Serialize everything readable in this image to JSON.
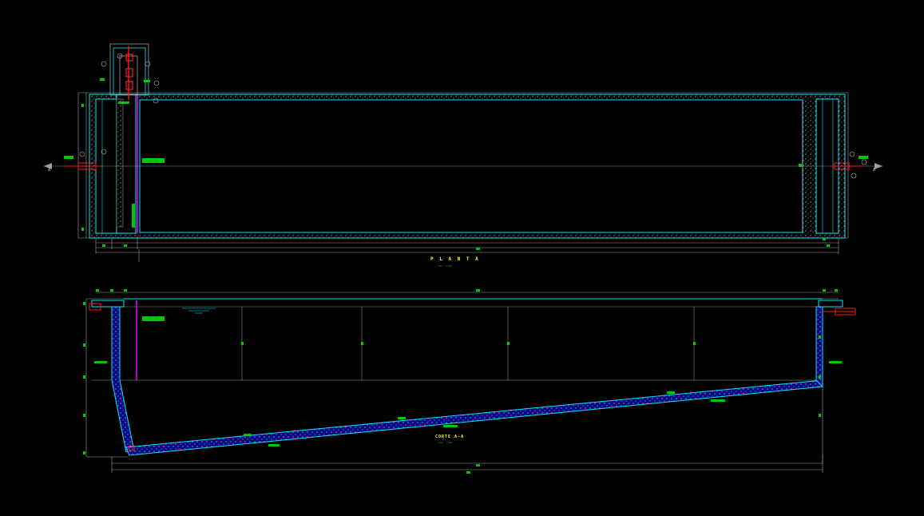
{
  "plan_view": {
    "title": "P L A N T A",
    "scale_note": "Esc. 1/50",
    "section_mark": "A"
  },
  "section_view": {
    "title": "CORTE A-A",
    "scale_note": "Esc. 1/50"
  },
  "colors": {
    "background": "#000000",
    "wall_outline": "#00e5ff",
    "concrete_hatch": "#9cc9c9",
    "dimension_line": "#b0b0b0",
    "dimension_marker": "#00c800",
    "pipe_fitting": "#ff1a1a",
    "drain_pipe": "#e600e6",
    "floor_slab": "#1414ff",
    "title_text": "#ffff00",
    "grid_line": "#8a8a8a"
  }
}
